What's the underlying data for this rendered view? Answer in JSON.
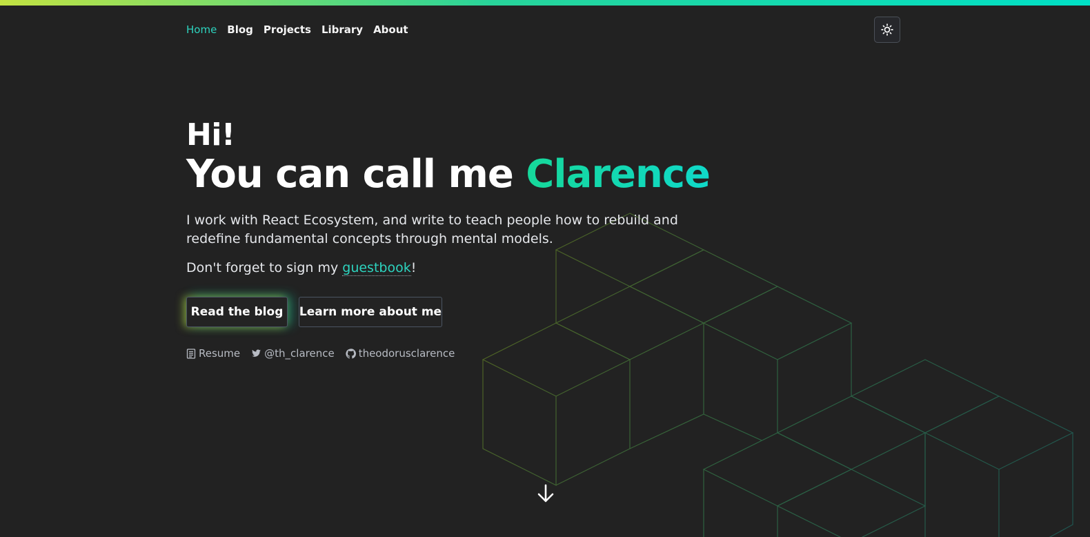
{
  "nav": {
    "items": [
      {
        "label": "Home",
        "active": true
      },
      {
        "label": "Blog",
        "active": false
      },
      {
        "label": "Projects",
        "active": false
      },
      {
        "label": "Library",
        "active": false
      },
      {
        "label": "About",
        "active": false
      }
    ],
    "theme_toggle_icon": "sun-icon"
  },
  "hero": {
    "greeting": "Hi!",
    "name_prefix": "You can call me ",
    "name": "Clarence",
    "description": "I work with React Ecosystem, and write to teach people how to rebuild and redefine fundamental concepts through mental models.",
    "guestbook_prefix": "Don't forget to sign my ",
    "guestbook_link": "guestbook",
    "guestbook_suffix": "!"
  },
  "buttons": {
    "primary": "Read the blog",
    "secondary": "Learn more about me"
  },
  "socials": [
    {
      "icon": "document-icon",
      "label": "Resume"
    },
    {
      "icon": "twitter-icon",
      "label": "@th_clarence"
    },
    {
      "icon": "github-icon",
      "label": "theodorusclarence"
    }
  ],
  "scroll_icon": "arrow-down-icon",
  "colors": {
    "background": "#222222",
    "accent": "#2dd4bf",
    "gradient_start": "#c3e342",
    "gradient_end": "#00e0c6"
  }
}
